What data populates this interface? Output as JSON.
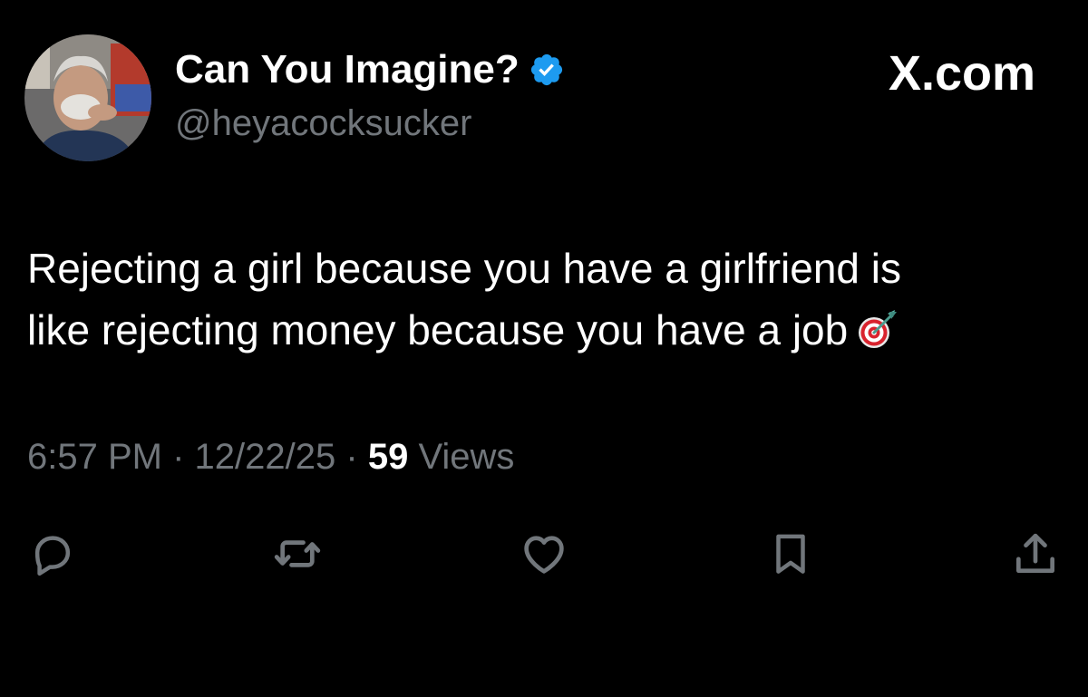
{
  "post": {
    "author": {
      "display_name": "Can You Imagine?",
      "handle": "@heyacocksucker",
      "verified_icon": "verified-badge-icon",
      "avatar_icon": "profile-photo"
    },
    "site_label": "X.com",
    "text_lines": [
      "Rejecting a girl because you have a girlfriend is",
      "like rejecting money because you have a job"
    ],
    "emoji_icon": "direct-hit-target-icon",
    "meta": {
      "time": "6:57 PM",
      "separator": "·",
      "date": "12/22/25",
      "views_count": "59",
      "views_label": "Views"
    },
    "actions": [
      {
        "name": "reply",
        "icon": "reply-icon"
      },
      {
        "name": "repost",
        "icon": "repost-icon"
      },
      {
        "name": "like",
        "icon": "heart-icon"
      },
      {
        "name": "bookmark",
        "icon": "bookmark-icon"
      },
      {
        "name": "share",
        "icon": "share-icon"
      }
    ]
  },
  "colors": {
    "background": "#000000",
    "primary_text": "#ffffff",
    "secondary_text": "#71767b",
    "verified_blue": "#1d9bf0"
  }
}
